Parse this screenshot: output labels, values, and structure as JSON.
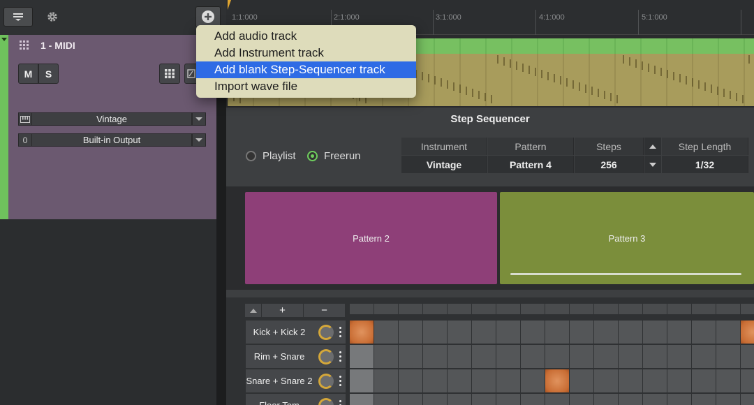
{
  "toolbar": {
    "menu_icon": "menu-icon",
    "settings_icon": "gear-icon",
    "add_icon": "plus-circle-icon"
  },
  "track": {
    "name": "1 - MIDI",
    "mute_label": "M",
    "solo_label": "S",
    "instrument_value": "Vintage",
    "output_channel": "0",
    "output_value": "Built-in Output",
    "color": "#6fc25d",
    "background": "#6b5970"
  },
  "ruler": {
    "labels": [
      "1:1:000",
      "2:1:000",
      "3:1:000",
      "4:1:000",
      "5:1:000"
    ]
  },
  "add_menu": {
    "items": [
      {
        "label": "Add audio track"
      },
      {
        "label": "Add Instrument track"
      },
      {
        "label": "Add blank Step-Sequencer track",
        "highlighted": true
      },
      {
        "label": "Import wave file"
      }
    ]
  },
  "sequencer": {
    "title": "Step Sequencer",
    "mode_playlist": "Playlist",
    "mode_freerun": "Freerun",
    "selected_mode": "Freerun",
    "headers": {
      "instrument": "Instrument",
      "pattern": "Pattern",
      "steps": "Steps",
      "step_length": "Step Length"
    },
    "values": {
      "instrument": "Vintage",
      "pattern": "Pattern 4",
      "steps": "256",
      "step_length": "1/32"
    },
    "patterns": [
      {
        "name": "Pattern 2",
        "color": "#8e3f78"
      },
      {
        "name": "Pattern 3",
        "color": "#7b8e3b"
      }
    ],
    "add_label": "+",
    "remove_label": "−",
    "lanes": [
      {
        "name": "Kick + Kick 2",
        "active_steps": [
          0,
          16
        ]
      },
      {
        "name": "Rim + Snare",
        "active_steps": []
      },
      {
        "name": "Snare + Snare 2",
        "active_steps": [
          8
        ]
      },
      {
        "name": "Floor Tom",
        "active_steps": []
      }
    ]
  }
}
